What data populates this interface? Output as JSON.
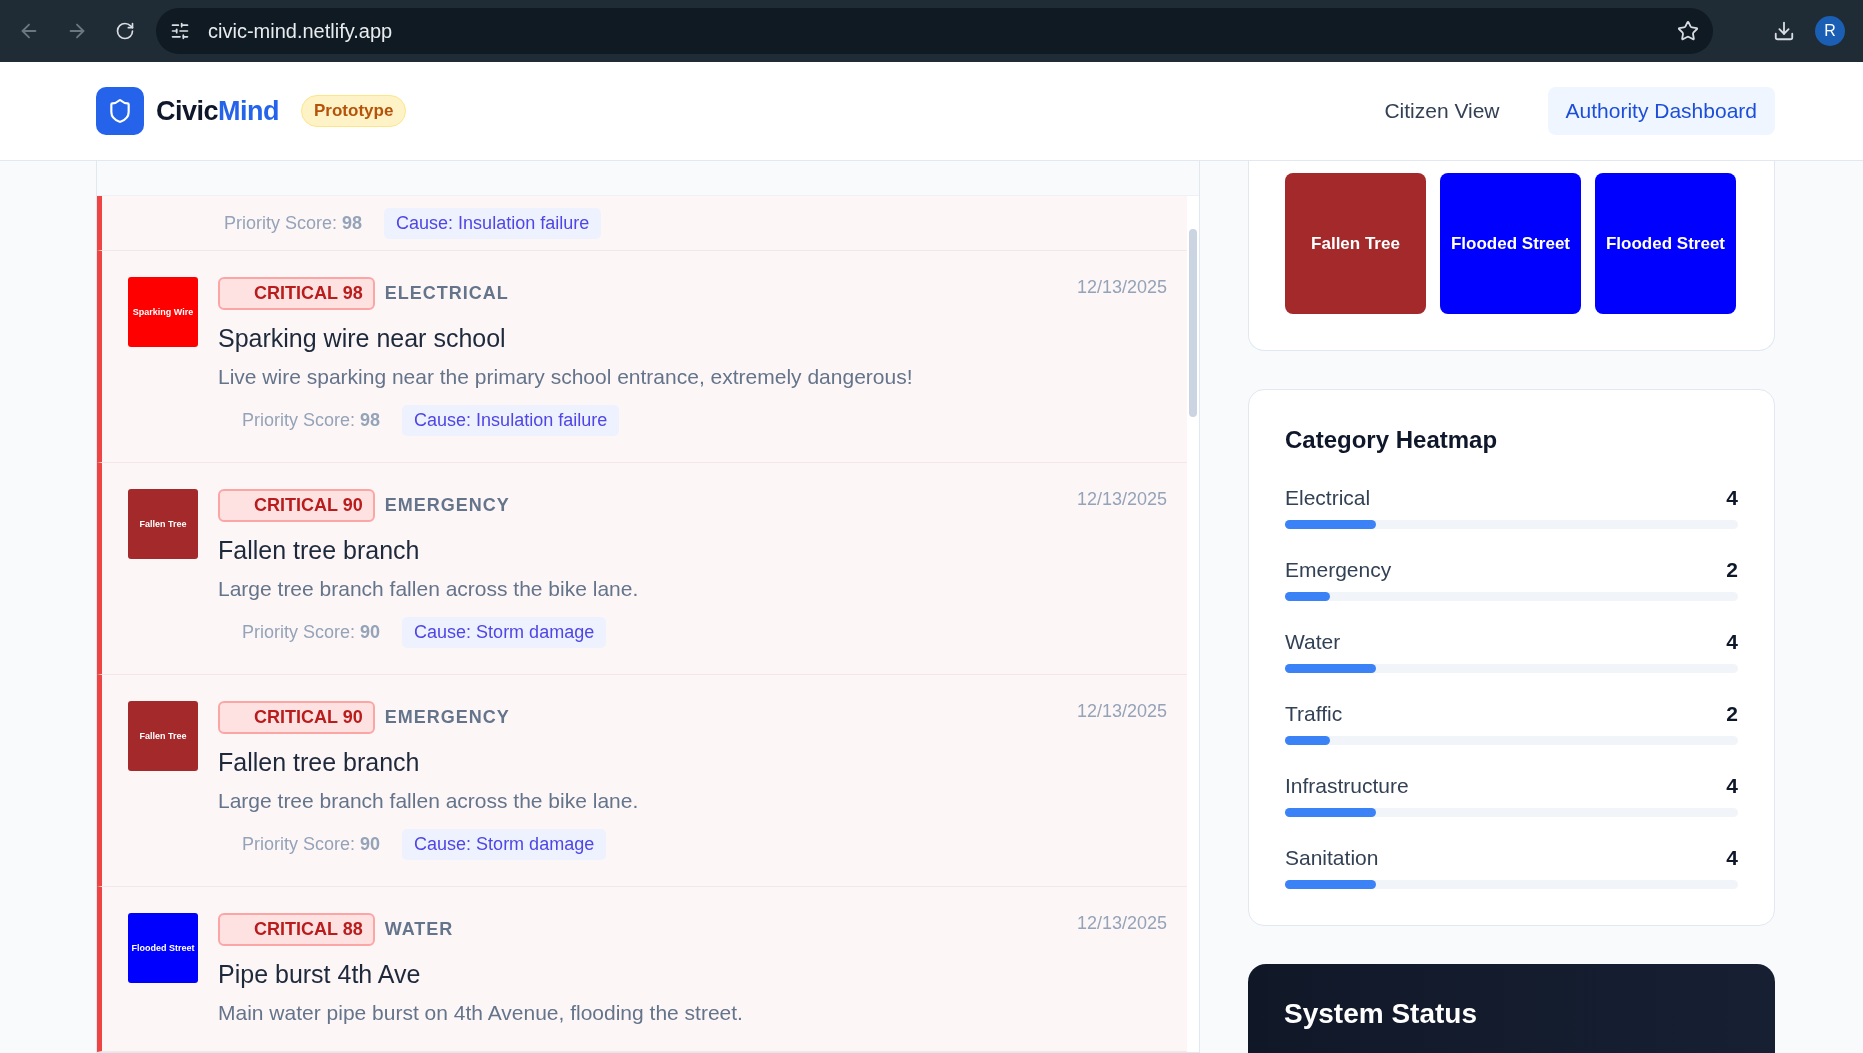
{
  "browser": {
    "url": "civic-mind.netlify.app",
    "profile_initial": "R"
  },
  "header": {
    "brand_first": "Civic",
    "brand_second": "Mind",
    "badge": "Prototype",
    "nav": [
      {
        "label": "Citizen View",
        "selected": false
      },
      {
        "label": "Authority Dashboard",
        "selected": true
      }
    ]
  },
  "reports": [
    {
      "score_label": "Priority Score:",
      "score": "98",
      "cause": "Cause: Insulation failure"
    },
    {
      "thumb": {
        "label": "Sparking Wire",
        "color": "#ff0000"
      },
      "badge": "CRITICAL 98",
      "category": "ELECTRICAL",
      "date": "12/13/2025",
      "title": "Sparking wire near school",
      "description": "Live wire sparking near the primary school entrance, extremely dangerous!",
      "score_label": "Priority Score:",
      "score": "98",
      "cause": "Cause: Insulation failure"
    },
    {
      "thumb": {
        "label": "Fallen Tree",
        "color": "#a4292b"
      },
      "badge": "CRITICAL 90",
      "category": "EMERGENCY",
      "date": "12/13/2025",
      "title": "Fallen tree branch",
      "description": "Large tree branch fallen across the bike lane.",
      "score_label": "Priority Score:",
      "score": "90",
      "cause": "Cause: Storm damage"
    },
    {
      "thumb": {
        "label": "Fallen Tree",
        "color": "#a4292b"
      },
      "badge": "CRITICAL 90",
      "category": "EMERGENCY",
      "date": "12/13/2025",
      "title": "Fallen tree branch",
      "description": "Large tree branch fallen across the bike lane.",
      "score_label": "Priority Score:",
      "score": "90",
      "cause": "Cause: Storm damage"
    },
    {
      "thumb": {
        "label": "Flooded Street",
        "color": "#0000ff"
      },
      "badge": "CRITICAL 88",
      "category": "WATER",
      "date": "12/13/2025",
      "title": "Pipe burst 4th Ave",
      "description": "Main water pipe burst on 4th Avenue, flooding the street."
    }
  ],
  "gallery": [
    {
      "label": "Fallen Tree",
      "color": "#a4292b"
    },
    {
      "label": "Flooded Street",
      "color": "#0000ff"
    },
    {
      "label": "Flooded Street",
      "color": "#0000ff"
    }
  ],
  "heatmap": {
    "title": "Category Heatmap",
    "rows": [
      {
        "name": "Electrical",
        "count": "4",
        "level": 0.2
      },
      {
        "name": "Emergency",
        "count": "2",
        "level": 0.1
      },
      {
        "name": "Water",
        "count": "4",
        "level": 0.2
      },
      {
        "name": "Traffic",
        "count": "2",
        "level": 0.1
      },
      {
        "name": "Infrastructure",
        "count": "4",
        "level": 0.2
      },
      {
        "name": "Sanitation",
        "count": "4",
        "level": 0.2
      }
    ]
  },
  "system_status": {
    "title": "System Status"
  }
}
